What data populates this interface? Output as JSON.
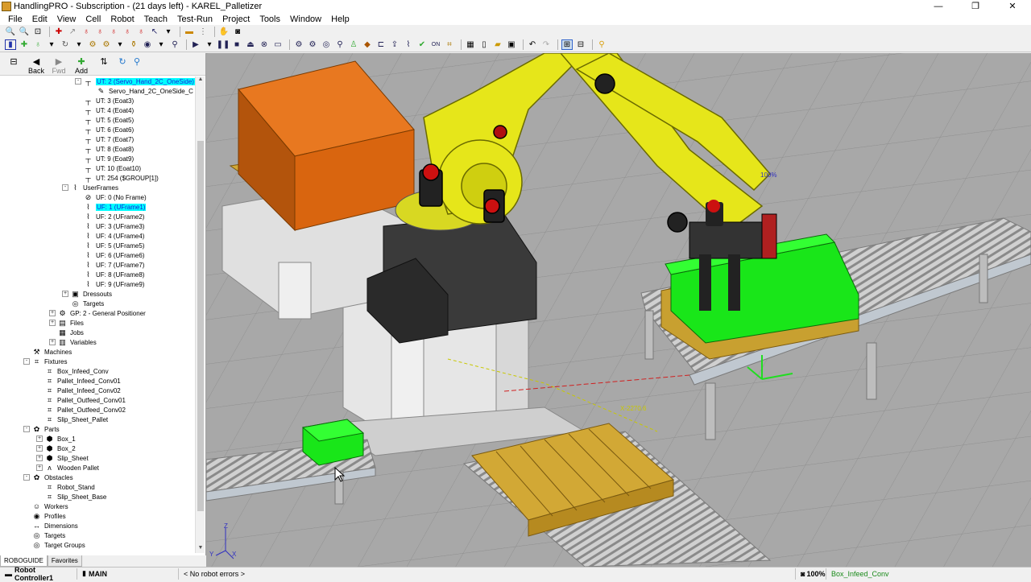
{
  "window": {
    "title": "HandlingPRO - Subscription - (21 days left) - KAREL_Palletizer",
    "minimize": "—",
    "restore": "❐",
    "close": "✕"
  },
  "menu": [
    "File",
    "Edit",
    "View",
    "Cell",
    "Robot",
    "Teach",
    "Test-Run",
    "Project",
    "Tools",
    "Window",
    "Help"
  ],
  "nav": {
    "back": "Back",
    "fwd": "Fwd",
    "add": "Add"
  },
  "tree": [
    {
      "indent": 104,
      "icon": "tool-icon",
      "glyph": "┬",
      "label": "UT: 2  (Servo_Hand_2C_OneSide)",
      "selected": true,
      "expander": "-"
    },
    {
      "indent": 120,
      "icon": "gripper-icon",
      "glyph": "✎",
      "label": "Servo_Hand_2C_OneSide_C"
    },
    {
      "indent": 104,
      "icon": "tool-icon",
      "glyph": "┬",
      "label": "UT: 3  (Eoat3)"
    },
    {
      "indent": 104,
      "icon": "tool-icon",
      "glyph": "┬",
      "label": "UT: 4  (Eoat4)"
    },
    {
      "indent": 104,
      "icon": "tool-icon",
      "glyph": "┬",
      "label": "UT: 5  (Eoat5)"
    },
    {
      "indent": 104,
      "icon": "tool-icon",
      "glyph": "┬",
      "label": "UT: 6  (Eoat6)"
    },
    {
      "indent": 104,
      "icon": "tool-icon",
      "glyph": "┬",
      "label": "UT: 7  (Eoat7)"
    },
    {
      "indent": 104,
      "icon": "tool-icon",
      "glyph": "┬",
      "label": "UT: 8  (Eoat8)"
    },
    {
      "indent": 104,
      "icon": "tool-icon",
      "glyph": "┬",
      "label": "UT: 9  (Eoat9)"
    },
    {
      "indent": 104,
      "icon": "tool-icon",
      "glyph": "┬",
      "label": "UT: 10  (Eoat10)"
    },
    {
      "indent": 104,
      "icon": "tool-icon",
      "glyph": "┬",
      "label": "UT: 254  ($GROUP[1])"
    },
    {
      "indent": 88,
      "icon": "userframes-icon",
      "glyph": "⌇",
      "label": "UserFrames",
      "expander": "-"
    },
    {
      "indent": 104,
      "icon": "no-frame-icon",
      "glyph": "⊘",
      "label": "UF: 0  (No Frame)"
    },
    {
      "indent": 104,
      "icon": "frame-icon",
      "glyph": "⌇",
      "label": "UF: 1  (UFrame1)",
      "selected": true
    },
    {
      "indent": 104,
      "icon": "frame-icon",
      "glyph": "⌇",
      "label": "UF: 2  (UFrame2)"
    },
    {
      "indent": 104,
      "icon": "frame-icon",
      "glyph": "⌇",
      "label": "UF: 3  (UFrame3)"
    },
    {
      "indent": 104,
      "icon": "frame-icon",
      "glyph": "⌇",
      "label": "UF: 4  (UFrame4)"
    },
    {
      "indent": 104,
      "icon": "frame-icon",
      "glyph": "⌇",
      "label": "UF: 5  (UFrame5)"
    },
    {
      "indent": 104,
      "icon": "frame-icon",
      "glyph": "⌇",
      "label": "UF: 6  (UFrame6)"
    },
    {
      "indent": 104,
      "icon": "frame-icon",
      "glyph": "⌇",
      "label": "UF: 7  (UFrame7)"
    },
    {
      "indent": 104,
      "icon": "frame-icon",
      "glyph": "⌇",
      "label": "UF: 8  (UFrame8)"
    },
    {
      "indent": 104,
      "icon": "frame-icon",
      "glyph": "⌇",
      "label": "UF: 9  (UFrame9)"
    },
    {
      "indent": 88,
      "icon": "dressout-icon",
      "glyph": "▣",
      "label": "Dressouts",
      "expander": "+"
    },
    {
      "indent": 88,
      "icon": "target-icon",
      "glyph": "◎",
      "label": "Targets"
    },
    {
      "indent": 72,
      "icon": "positioner-icon",
      "glyph": "⚙",
      "label": "GP: 2 - General Positioner",
      "expander": "+"
    },
    {
      "indent": 72,
      "icon": "files-icon",
      "glyph": "▤",
      "label": "Files",
      "expander": "+"
    },
    {
      "indent": 72,
      "icon": "jobs-icon",
      "glyph": "▦",
      "label": "Jobs"
    },
    {
      "indent": 72,
      "icon": "variables-icon",
      "glyph": "▥",
      "label": "Variables",
      "expander": "+"
    },
    {
      "indent": 40,
      "icon": "machines-icon",
      "glyph": "⚒",
      "label": "Machines"
    },
    {
      "indent": 40,
      "icon": "fixtures-icon",
      "glyph": "⌗",
      "label": "Fixtures",
      "expander": "-"
    },
    {
      "indent": 56,
      "icon": "fixture-icon",
      "glyph": "⌗",
      "label": "Box_Infeed_Conv"
    },
    {
      "indent": 56,
      "icon": "fixture-icon",
      "glyph": "⌗",
      "label": "Pallet_Infeed_Conv01"
    },
    {
      "indent": 56,
      "icon": "fixture-icon",
      "glyph": "⌗",
      "label": "Pallet_Infeed_Conv02"
    },
    {
      "indent": 56,
      "icon": "fixture-icon",
      "glyph": "⌗",
      "label": "Pallet_Outfeed_Conv01"
    },
    {
      "indent": 56,
      "icon": "fixture-icon",
      "glyph": "⌗",
      "label": "Pallet_Outfeed_Conv02"
    },
    {
      "indent": 56,
      "icon": "fixture-icon",
      "glyph": "⌗",
      "label": "Slip_Sheet_Pallet"
    },
    {
      "indent": 40,
      "icon": "parts-icon",
      "glyph": "✿",
      "label": "Parts",
      "expander": "-"
    },
    {
      "indent": 56,
      "icon": "part-icon",
      "glyph": "⬢",
      "label": "Box_1",
      "expander": "+"
    },
    {
      "indent": 56,
      "icon": "part-icon",
      "glyph": "⬢",
      "label": "Box_2",
      "expander": "+"
    },
    {
      "indent": 56,
      "icon": "part-icon",
      "glyph": "⬢",
      "label": "Slip_Sheet",
      "expander": "+"
    },
    {
      "indent": 56,
      "icon": "pallet-part-icon",
      "glyph": "ᴧ",
      "label": "Wooden Pallet",
      "expander": "+"
    },
    {
      "indent": 40,
      "icon": "obstacles-icon",
      "glyph": "✿",
      "label": "Obstacles",
      "expander": "-"
    },
    {
      "indent": 56,
      "icon": "obstacle-icon",
      "glyph": "⌗",
      "label": "Robot_Stand"
    },
    {
      "indent": 56,
      "icon": "obstacle-icon",
      "glyph": "⌗",
      "label": "Slip_Sheet_Base"
    },
    {
      "indent": 40,
      "icon": "workers-icon",
      "glyph": "☺",
      "label": "Workers"
    },
    {
      "indent": 40,
      "icon": "profiles-icon",
      "glyph": "◉",
      "label": "Profiles"
    },
    {
      "indent": 40,
      "icon": "dimensions-icon",
      "glyph": "↔",
      "label": "Dimensions"
    },
    {
      "indent": 40,
      "icon": "targets-icon",
      "glyph": "◎",
      "label": "Targets"
    },
    {
      "indent": 40,
      "icon": "target-groups-icon",
      "glyph": "◎",
      "label": "Target Groups"
    }
  ],
  "tabs": [
    "ROBOGUIDE",
    "Favorites"
  ],
  "viewport": {
    "speed_label": "100%",
    "coord_label": "X-2270.6",
    "axis_z": "Z",
    "axis_x": "X",
    "axis_y": "Y"
  },
  "status": {
    "controller": "Robot Controller1",
    "program": "MAIN",
    "errors": "< No robot errors >",
    "zoom": "100%",
    "selected": "Box_Infeed_Conv"
  },
  "colors": {
    "robot_yellow": "#e6e61a",
    "box_green": "#19e619",
    "box_orange": "#d9650f",
    "pallet_wood": "#c8a030",
    "floor": "#a8a8a8",
    "selection": "#00ffff"
  }
}
